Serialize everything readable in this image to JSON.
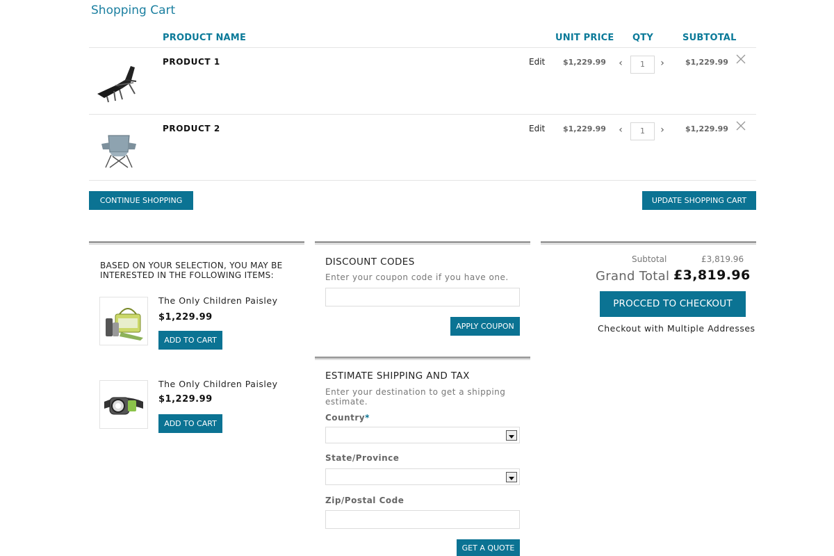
{
  "page": {
    "title": "Shopping Cart"
  },
  "table": {
    "headers": {
      "product_name": "PRODUCT NAME",
      "unit_price": "UNIT PRICE",
      "qty": "QTY",
      "subtotal": "SUBTOTAL"
    },
    "rows": [
      {
        "name": "PRODUCT 1",
        "edit_label": "Edit",
        "unit_price": "$1,229.99",
        "qty": "1",
        "subtotal": "$1,229.99",
        "image_icon": "lounge-chair-icon"
      },
      {
        "name": "PRODUCT 2",
        "edit_label": "Edit",
        "unit_price": "$1,229.99",
        "qty": "1",
        "subtotal": "$1,229.99",
        "image_icon": "folding-chair-icon"
      }
    ]
  },
  "actions": {
    "continue_shopping": "CONTINUE SHOPPING",
    "update_cart": "UPDATE SHOPPING CART"
  },
  "recommendations": {
    "heading": "BASED ON YOUR SELECTION, YOU MAY BE INTERESTED IN THE FOLLOWING ITEMS:",
    "items": [
      {
        "name": "The Only Children Paisley",
        "price": "$1,229.99",
        "button": "ADD TO CART",
        "image_icon": "picnic-set-icon"
      },
      {
        "name": "The Only Children Paisley",
        "price": "$1,229.99",
        "button": "ADD TO CART",
        "image_icon": "headlamp-icon"
      }
    ]
  },
  "discount": {
    "title": "DISCOUNT CODES",
    "subtitle": "Enter your coupon code if you have one.",
    "input_value": "",
    "button": "APPLY COUPON"
  },
  "shipping": {
    "title": "ESTIMATE SHIPPING AND TAX",
    "subtitle_line1": "Enter your destination to get a shipping",
    "subtitle_line2": "estimate.",
    "country_label": "Country",
    "required_mark": "*",
    "country_value": "",
    "state_label": "State/Province",
    "state_value": "",
    "zip_label": "Zip/Postal Code",
    "zip_value": "",
    "button": "GET A QUOTE"
  },
  "totals": {
    "subtotal_label": "Subtotal",
    "subtotal_value": "£3,819.96",
    "grand_total_label": "Grand Total",
    "grand_total_value": "£3,819.96",
    "checkout_button": "PROCCED TO CHECKOUT",
    "multi_address_link": "Checkout with Multiple Addresses"
  },
  "colors": {
    "accent": "#0b7393",
    "title": "#1b7fa0",
    "header": "#0b7a99"
  }
}
